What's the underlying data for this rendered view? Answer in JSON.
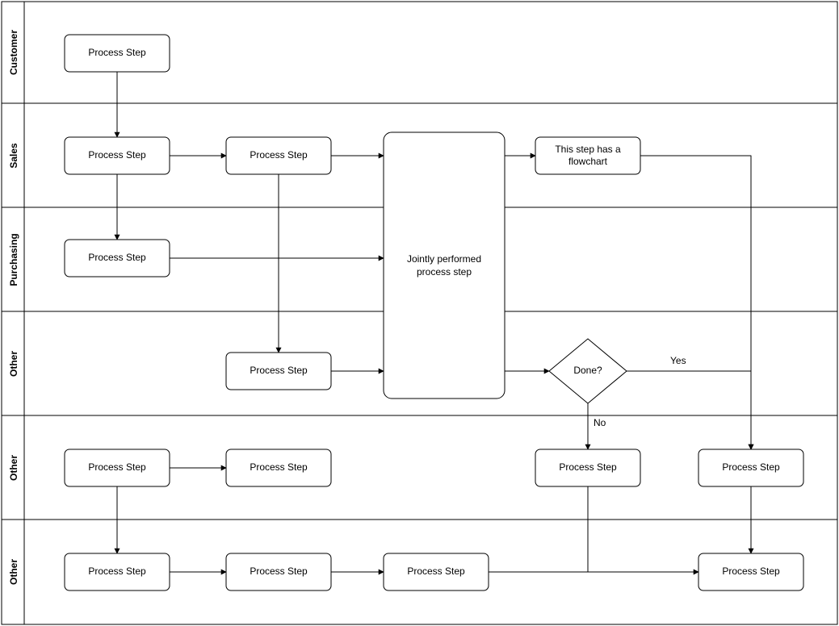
{
  "lanes": [
    {
      "id": "customer",
      "label": "Customer"
    },
    {
      "id": "sales",
      "label": "Sales"
    },
    {
      "id": "purchasing",
      "label": "Purchasing"
    },
    {
      "id": "other1",
      "label": "Other"
    },
    {
      "id": "other2",
      "label": "Other"
    },
    {
      "id": "other3",
      "label": "Other"
    }
  ],
  "nodes": {
    "n1": "Process Step",
    "n2": "Process Step",
    "n3": "Process Step",
    "n4": "Process Step",
    "n5_line1": "Jointly performed",
    "n5_line2": "process step",
    "n6_line1": "This step has a",
    "n6_line2": "flowchart",
    "n7": "Process Step",
    "n8": "Done?",
    "n9": "Process Step",
    "n10": "Process Step",
    "n11": "Process Step",
    "n12": "Process Step",
    "n13": "Process Step",
    "n14": "Process Step",
    "n15": "Process Step",
    "n16": "Process Step"
  },
  "edges": {
    "yes": "Yes",
    "no": "No"
  }
}
